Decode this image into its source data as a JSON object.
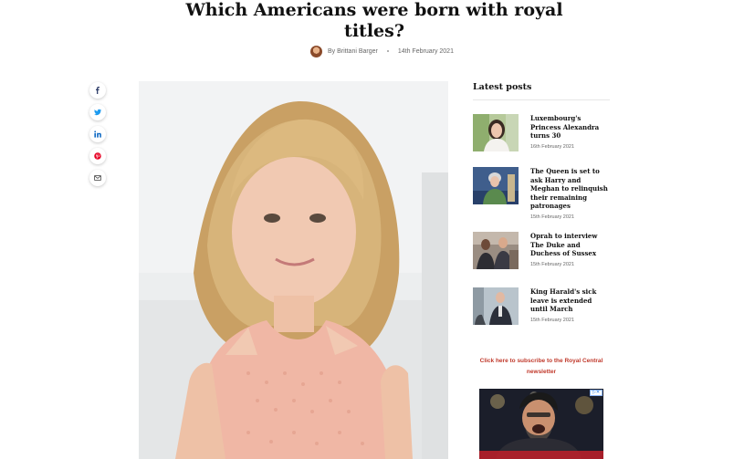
{
  "article": {
    "title": "Which Americans were born with royal titles?",
    "author": "By Brittani Barger",
    "date": "14th February 2021"
  },
  "share": {
    "items": [
      {
        "name": "facebook-icon",
        "glyph": "f"
      },
      {
        "name": "twitter-icon",
        "glyph": "t"
      },
      {
        "name": "linkedin-icon",
        "glyph": "in"
      },
      {
        "name": "pinterest-icon",
        "glyph": "p"
      },
      {
        "name": "email-icon",
        "glyph": "mail"
      }
    ]
  },
  "sidebar": {
    "heading": "Latest posts",
    "posts": [
      {
        "title": "Luxembourg's Princess Alexandra turns 30",
        "date": "16th February 2021"
      },
      {
        "title": "The Queen is set to ask Harry and Meghan to relinquish their remaining patronages",
        "date": "15th February 2021"
      },
      {
        "title": "Oprah to interview The Duke and Duchess of Sussex",
        "date": "15th February 2021"
      },
      {
        "title": "King Harald's sick leave is extended until March",
        "date": "15th February 2021"
      }
    ],
    "subscribe": "Click here to subscribe to the Royal Central newsletter"
  },
  "colors": {
    "accent_red": "#c0392b",
    "link_icon": "#2b3a67"
  }
}
